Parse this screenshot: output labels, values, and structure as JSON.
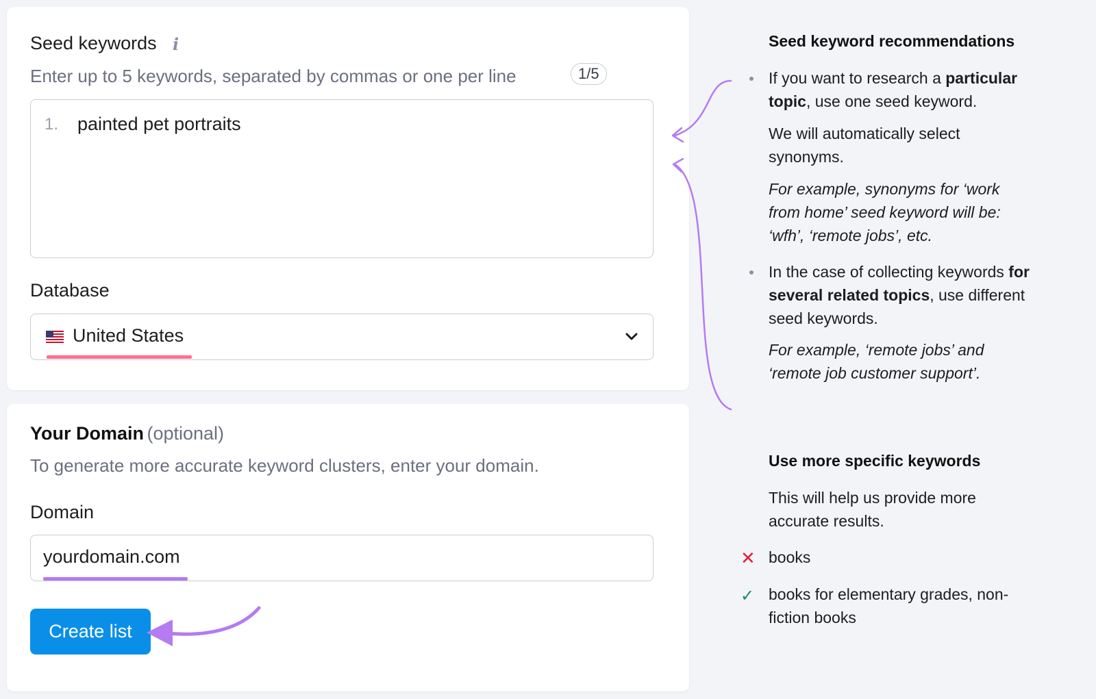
{
  "seed": {
    "label": "Seed keywords",
    "info_icon": "info-icon",
    "hint": "Enter up to 5 keywords, separated by commas or one per line",
    "counter": "1/5",
    "line_number": "1.",
    "keyword": "painted pet portraits"
  },
  "database": {
    "label": "Database",
    "selected": "United States",
    "flag_icon": "us-flag-icon",
    "chevron_icon": "chevron-down-icon",
    "highlight_color": "#ff6f8f"
  },
  "domain_section": {
    "title": "Your Domain",
    "optional": "(optional)",
    "hint": "To generate more accurate keyword clusters, enter your domain.",
    "field_label": "Domain",
    "value": "yourdomain.com",
    "highlight_color": "#b57bf1"
  },
  "create_button": {
    "label": "Create list",
    "color": "#0a8fe8"
  },
  "recommendations": {
    "heading": "Seed keyword recommendations",
    "bullet1": {
      "pre": "If you want to research a ",
      "bold1": "particular",
      "bold2": "topic",
      "post": ", use one seed keyword.",
      "para2a": "We will automatically select",
      "para2b": "synonyms.",
      "ex_line1": "For example, synonyms for ‘work",
      "ex_line2": "from home’ seed keyword will be:",
      "ex_line3": "‘wfh’, ‘remote jobs’, etc."
    },
    "bullet2": {
      "pre": "In the case of collecting keywords ",
      "bold1": "for",
      "bold2": "several related topics",
      "post": ", use different",
      "line3": "seed keywords.",
      "ex_line1": "For example, ‘remote jobs’ and",
      "ex_line2": "‘remote job customer support’."
    }
  },
  "specific": {
    "heading": "Use more specific keywords",
    "line1": "This will help us provide more",
    "line2": "accurate results.",
    "bad_example": "books",
    "good_line1": "books for elementary grades, non-",
    "good_line2": "fiction books",
    "bad_icon": "x-mark-icon",
    "good_icon": "checkmark-icon"
  },
  "annotation_color": "#b57bf1"
}
